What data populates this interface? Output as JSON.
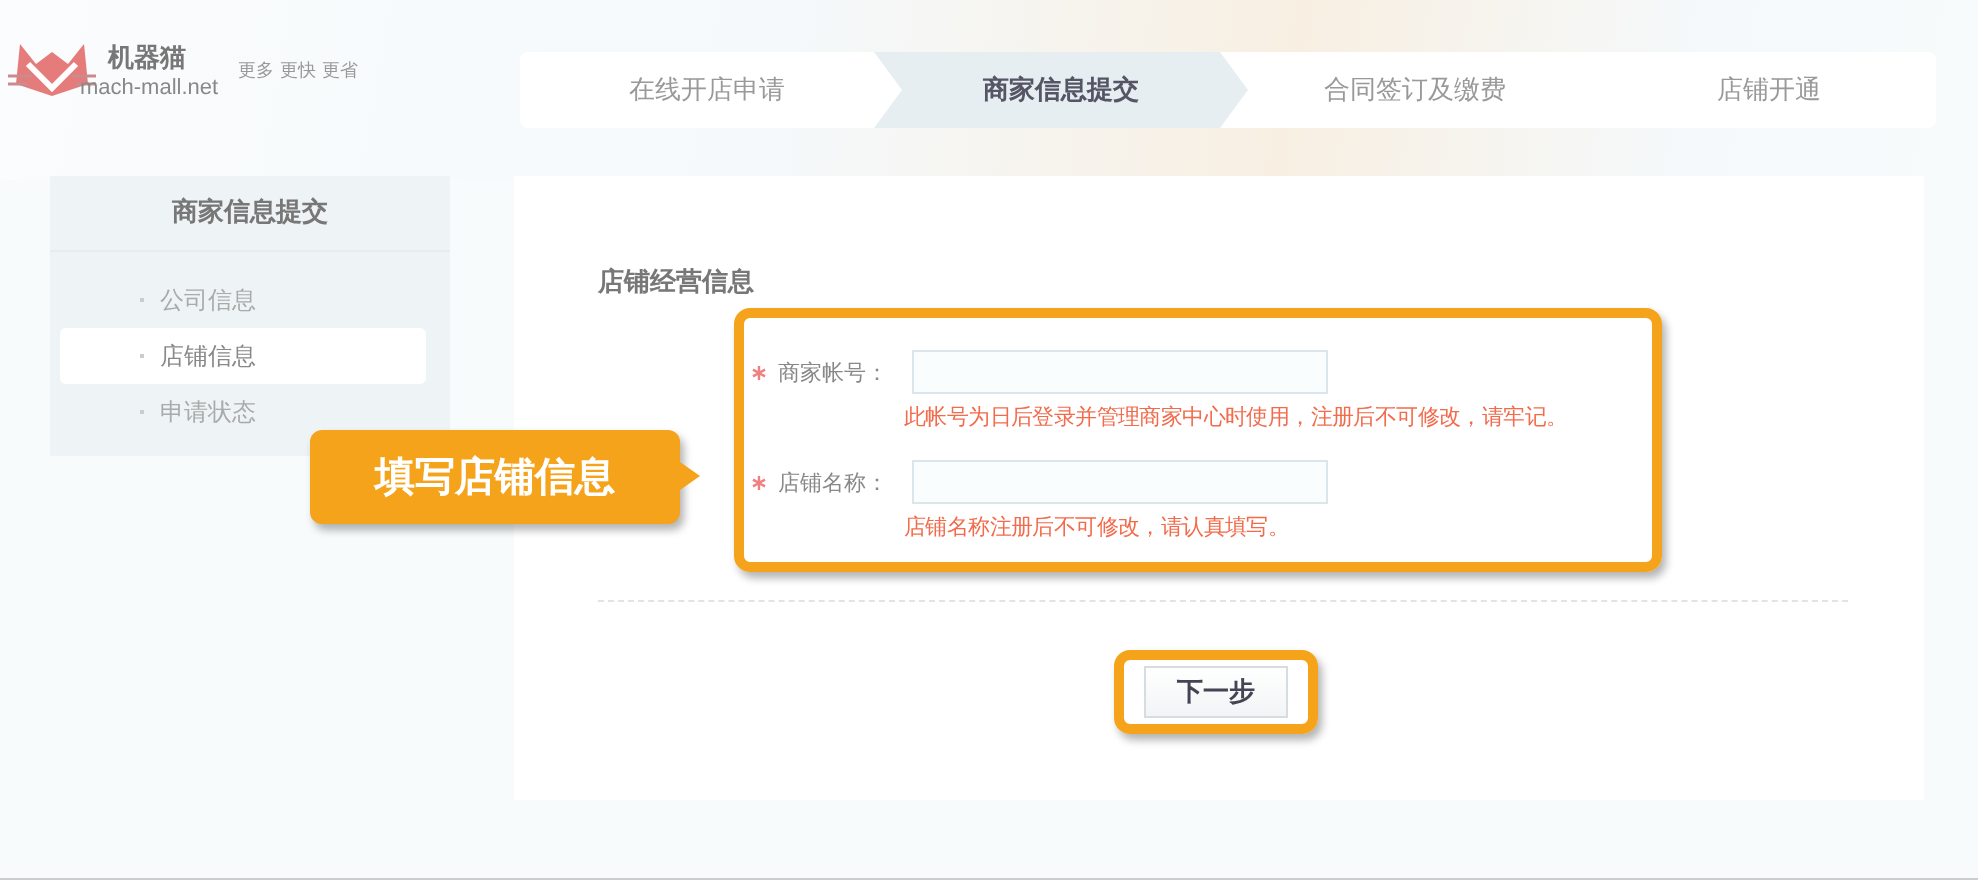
{
  "logo": {
    "name": "机器猫",
    "domain": "mach-mall.net",
    "slogan": "更多 更快 更省"
  },
  "steps": [
    {
      "label": "在线开店申请",
      "selected": false
    },
    {
      "label": "商家信息提交",
      "selected": true
    },
    {
      "label": "合同签订及缴费",
      "selected": false
    },
    {
      "label": "店铺开通",
      "selected": false
    }
  ],
  "sidebar": {
    "title": "商家信息提交",
    "items": [
      {
        "label": "公司信息",
        "selected": false
      },
      {
        "label": "店铺信息",
        "selected": true
      },
      {
        "label": "申请状态",
        "selected": false
      }
    ]
  },
  "section_title": "店铺经营信息",
  "callout": "填写店铺信息",
  "fields": [
    {
      "label": "商家帐号：",
      "required": true,
      "hint": "此帐号为日后登录并管理商家中心时使用，注册后不可修改，请牢记。"
    },
    {
      "label": "店铺名称：",
      "required": true,
      "hint": "店铺名称注册后不可修改，请认真填写。"
    }
  ],
  "next_button": "下一步"
}
